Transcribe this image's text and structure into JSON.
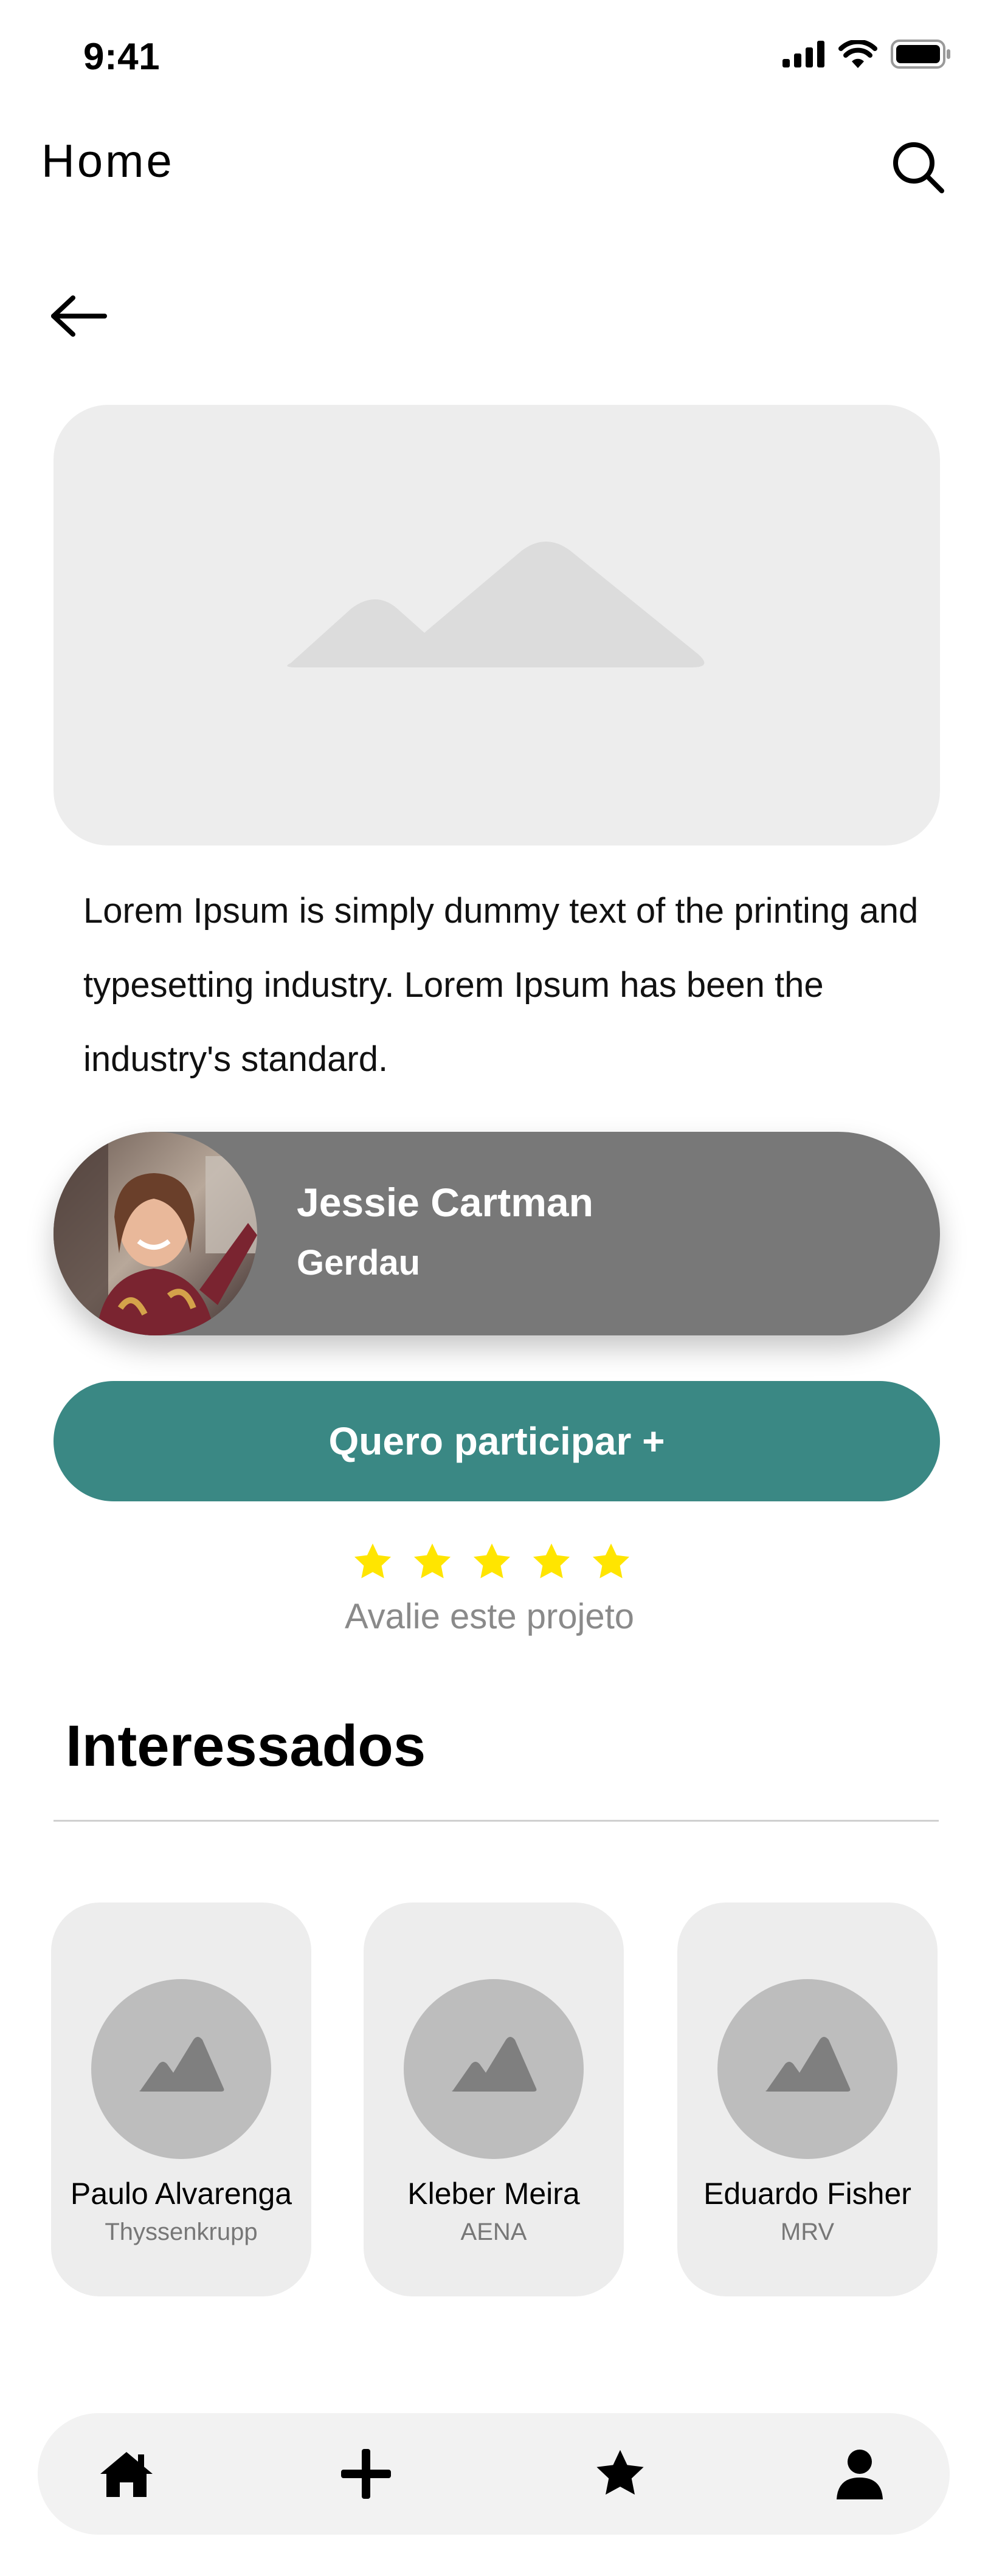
{
  "status_bar": {
    "time": "9:41",
    "icons": [
      "signal-icon",
      "wifi-icon",
      "battery-icon"
    ]
  },
  "header": {
    "title": "Home",
    "search_icon": "search-icon"
  },
  "navigation": {
    "back_icon": "arrow-left-icon"
  },
  "hero": {
    "image_icon": "image-placeholder-icon"
  },
  "description": "Lorem Ipsum is simply dummy text of the printing and typesetting industry. Lorem Ipsum has been the industry's standard.",
  "host": {
    "name": "Jessie Cartman",
    "company": "Gerdau"
  },
  "cta": {
    "label": "Quero participar +"
  },
  "rating": {
    "stars": 5,
    "label": "Avalie este projeto",
    "star_color": "#FFE500"
  },
  "interested": {
    "title": "Interessados",
    "people": [
      {
        "name": "Paulo Alvarenga",
        "company": "Thyssenkrupp"
      },
      {
        "name": "Kleber Meira",
        "company": "AENA"
      },
      {
        "name": "Eduardo Fisher",
        "company": "MRV"
      }
    ]
  },
  "bottom_nav": {
    "items": [
      "home-icon",
      "plus-icon",
      "star-icon",
      "user-icon"
    ]
  },
  "colors": {
    "accent": "#3A8884",
    "host_card": "#787878",
    "placeholder": "#EDEDED"
  }
}
